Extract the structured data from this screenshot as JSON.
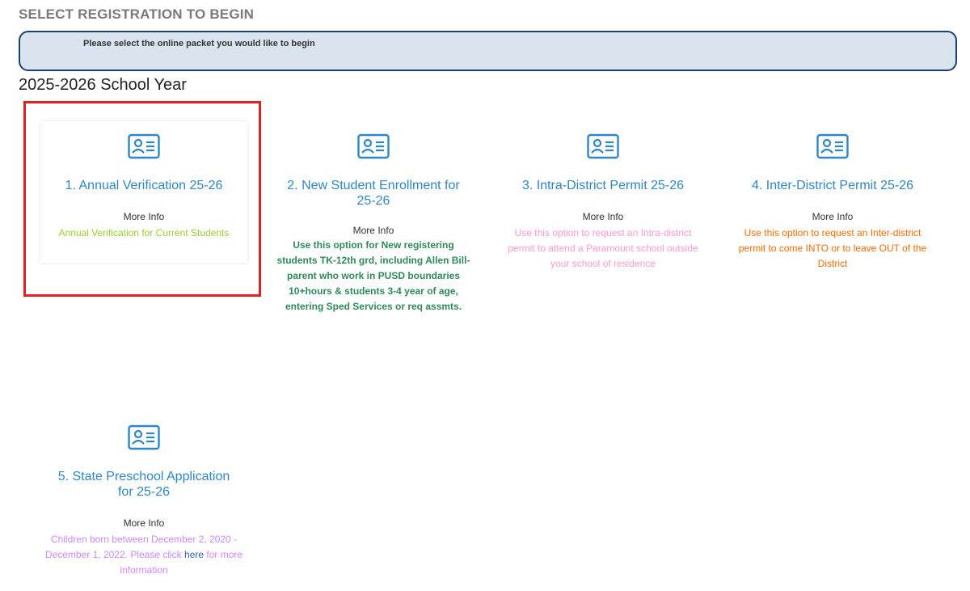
{
  "header": {
    "title": "SELECT REGISTRATION TO BEGIN",
    "notice": "Please select the online packet you would like to begin"
  },
  "school_year": "2025-2026 School Year",
  "cards": [
    {
      "icon": "id-card-icon",
      "title": "1. Annual Verification 25-26",
      "more_info": "More Info",
      "description": "Annual Verification for Current Students",
      "description_color": "#9acd32"
    },
    {
      "icon": "id-card-icon",
      "title": "2. New Student Enrollment for 25-26",
      "more_info": "More Info",
      "description": "Use this option for New registering students TK-12th grd, including Allen Bill-parent who work in PUSD boundaries 10+hours & students 3-4 year of age, entering Sped Services or req assmts.",
      "description_color": "#2e8b57"
    },
    {
      "icon": "id-card-icon",
      "title": "3. Intra-District Permit 25-26",
      "more_info": "More Info",
      "description": "Use this option to request an Intra-district permit to attend a Paramount school outside your school of residence",
      "description_color": "#ff99cc"
    },
    {
      "icon": "id-card-icon",
      "title": "4. Inter-District Permit 25-26",
      "more_info": "More Info",
      "description": "Use this option to request an Inter-district permit to come INTO or to leave OUT of the District",
      "description_color": "#ff6a00"
    },
    {
      "icon": "id-card-icon",
      "title": "5. State Preschool Application for 25-26",
      "more_info": "More Info",
      "description_before": "Children born between December 2, 2020 - December 1, 2022. Please click ",
      "link_text": "here",
      "description_after": " for more information",
      "description_color": "#cc88ff"
    }
  ],
  "colors": {
    "title_blue": "#2f86c6",
    "notice_bg": "#d9e4ef",
    "notice_border": "#1f3f73",
    "highlight_red": "#e02121"
  }
}
